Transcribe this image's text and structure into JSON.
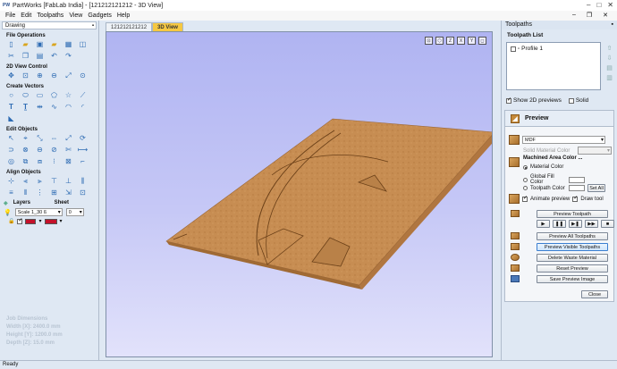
{
  "window": {
    "title": "PartWorks [FabLab India] - [121212121212 - 3D View]",
    "app_icon": "PW"
  },
  "menu": [
    "File",
    "Edit",
    "Toolpaths",
    "View",
    "Gadgets",
    "Help"
  ],
  "left_panel": {
    "tab_label": "Drawing",
    "sections": {
      "file_operations": "File Operations",
      "view_control": "2D View Control",
      "create_vectors": "Create Vectors",
      "edit_objects": "Edit Objects",
      "align_objects": "Align Objects"
    },
    "layers_label": "Layers",
    "sheet_label": "Sheet",
    "layer_value": "Scale 1_30 ß",
    "sheet_value": "0",
    "job_dimensions": {
      "title": "Job Dimensions",
      "width": "Width  [X]: 2400.0 mm",
      "height": "Height [Y]: 1200.0 mm",
      "depth": "Depth  [Z]: 15.0 mm"
    }
  },
  "tabs": [
    {
      "label": "121212121212",
      "active": false
    },
    {
      "label": "3D View",
      "active": true
    }
  ],
  "viewport": {
    "icons": [
      "fit-icon",
      "iso-view-icon",
      "top-view-icon",
      "front-view-icon",
      "side-view-icon",
      "ortho-icon"
    ]
  },
  "right_panel": {
    "header": "Toolpaths",
    "list_title": "Toolpath List",
    "toolpaths": [
      "Profile 1"
    ],
    "show_2d_previews": "Show 2D previews",
    "solid": "Solid",
    "preview_title": "Preview",
    "material_select": "MDF",
    "solid_material_color": "Solid Material Color",
    "machined_area_color": "Machined Area Color ...",
    "material_color": "Material Color",
    "global_fill_color": "Global Fill Color",
    "toolpath_color": "Toolpath Color",
    "set_all": "Set All",
    "animate_preview": "Animate preview",
    "draw_tool": "Draw tool",
    "buttons": {
      "preview_toolpath": "Preview Toolpath",
      "preview_all": "Preview All Toolpaths",
      "preview_visible": "Preview Visible Toolpaths",
      "delete_waste": "Delete Waste Material",
      "reset_preview": "Reset Preview",
      "save_image": "Save Preview Image",
      "close": "Close"
    }
  },
  "status": "Ready",
  "colors": {
    "accent_tab": "#f5c842",
    "panel_bg": "#dfe8f3",
    "material": "#c48a4e",
    "viewport_top": "#b0b4f2"
  }
}
